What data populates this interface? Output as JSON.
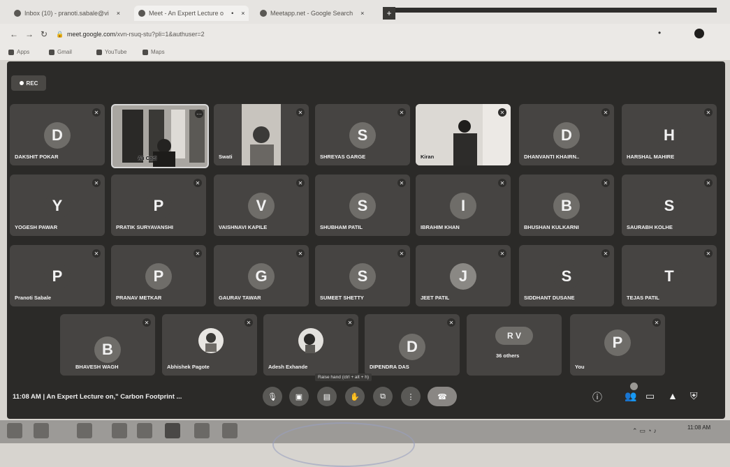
{
  "browser": {
    "tabs": [
      {
        "label": "Inbox (10) - pranoti.sabale@vi"
      },
      {
        "label": "Meet - An Expert Lecture o"
      },
      {
        "label": "Meetapp.net - Google Search"
      }
    ],
    "url_host": "meet.google.com",
    "url_rest": "/xvn-rsuq-stu?pli=1&authuser=2",
    "bookmarks": [
      "Apps",
      "Gmail",
      "YouTube",
      "Maps"
    ]
  },
  "meet": {
    "rec_label": "REC",
    "participants": [
      {
        "name": "DAKSHIT POKAR",
        "initial": "D",
        "type": "avatar"
      },
      {
        "name": "Ali Cadi",
        "initial": "",
        "type": "video"
      },
      {
        "name": "Swati",
        "initial": "",
        "type": "video"
      },
      {
        "name": "SHREYAS GARGE",
        "initial": "S",
        "type": "avatar"
      },
      {
        "name": "Kiran",
        "initial": "",
        "type": "video"
      },
      {
        "name": "DHANVANTI KHAIRN..",
        "initial": "D",
        "type": "avatar"
      },
      {
        "name": "HARSHAL MAHIRE",
        "initial": "H",
        "type": "avatar"
      },
      {
        "name": "YOGESH PAWAR",
        "initial": "Y",
        "type": "avatar"
      },
      {
        "name": "PRATIK SURYAVANSHI",
        "initial": "P",
        "type": "avatar"
      },
      {
        "name": "VAISHNAVI KAPILE",
        "initial": "V",
        "type": "avatar"
      },
      {
        "name": "SHUBHAM PATIL",
        "initial": "S",
        "type": "avatar"
      },
      {
        "name": "IBRAHIM KHAN",
        "initial": "I",
        "type": "avatar"
      },
      {
        "name": "BHUSHAN KULKARNI",
        "initial": "B",
        "type": "avatar"
      },
      {
        "name": "SAURABH KOLHE",
        "initial": "S",
        "type": "avatar"
      },
      {
        "name": "Pranoti Sabale",
        "initial": "P",
        "type": "avatar"
      },
      {
        "name": "PRANAV METKAR",
        "initial": "P",
        "type": "avatar"
      },
      {
        "name": "GAURAV TAWAR",
        "initial": "G",
        "type": "avatar"
      },
      {
        "name": "SUMEET SHETTY",
        "initial": "S",
        "type": "avatar"
      },
      {
        "name": "JEET PATIL",
        "initial": "J",
        "type": "avatar"
      },
      {
        "name": "SIDDHANT DUSANE",
        "initial": "S",
        "type": "avatar"
      },
      {
        "name": "TEJAS PATIL",
        "initial": "T",
        "type": "avatar"
      },
      {
        "name": "BHAVESH WAGH",
        "initial": "B",
        "type": "avatar"
      },
      {
        "name": "Abhishek Pagote",
        "initial": "",
        "type": "photo"
      },
      {
        "name": "Adesh Exhande",
        "initial": "",
        "type": "photo"
      },
      {
        "name": "DIPENDRA DAS",
        "initial": "D",
        "type": "avatar"
      },
      {
        "name": "36 others",
        "initial": "R V",
        "type": "others"
      },
      {
        "name": "You",
        "initial": "P",
        "type": "avatar"
      }
    ],
    "time": "11:08 AM",
    "separator": "|",
    "meeting_title": "An Expert Lecture on,\" Carbon Footprint ...",
    "raise_hand_tooltip": "Raise hand (ctrl + alt + h)",
    "participant_count_badge": ""
  },
  "taskbar": {
    "clock_time": "11:08 AM",
    "clock_date": ""
  }
}
